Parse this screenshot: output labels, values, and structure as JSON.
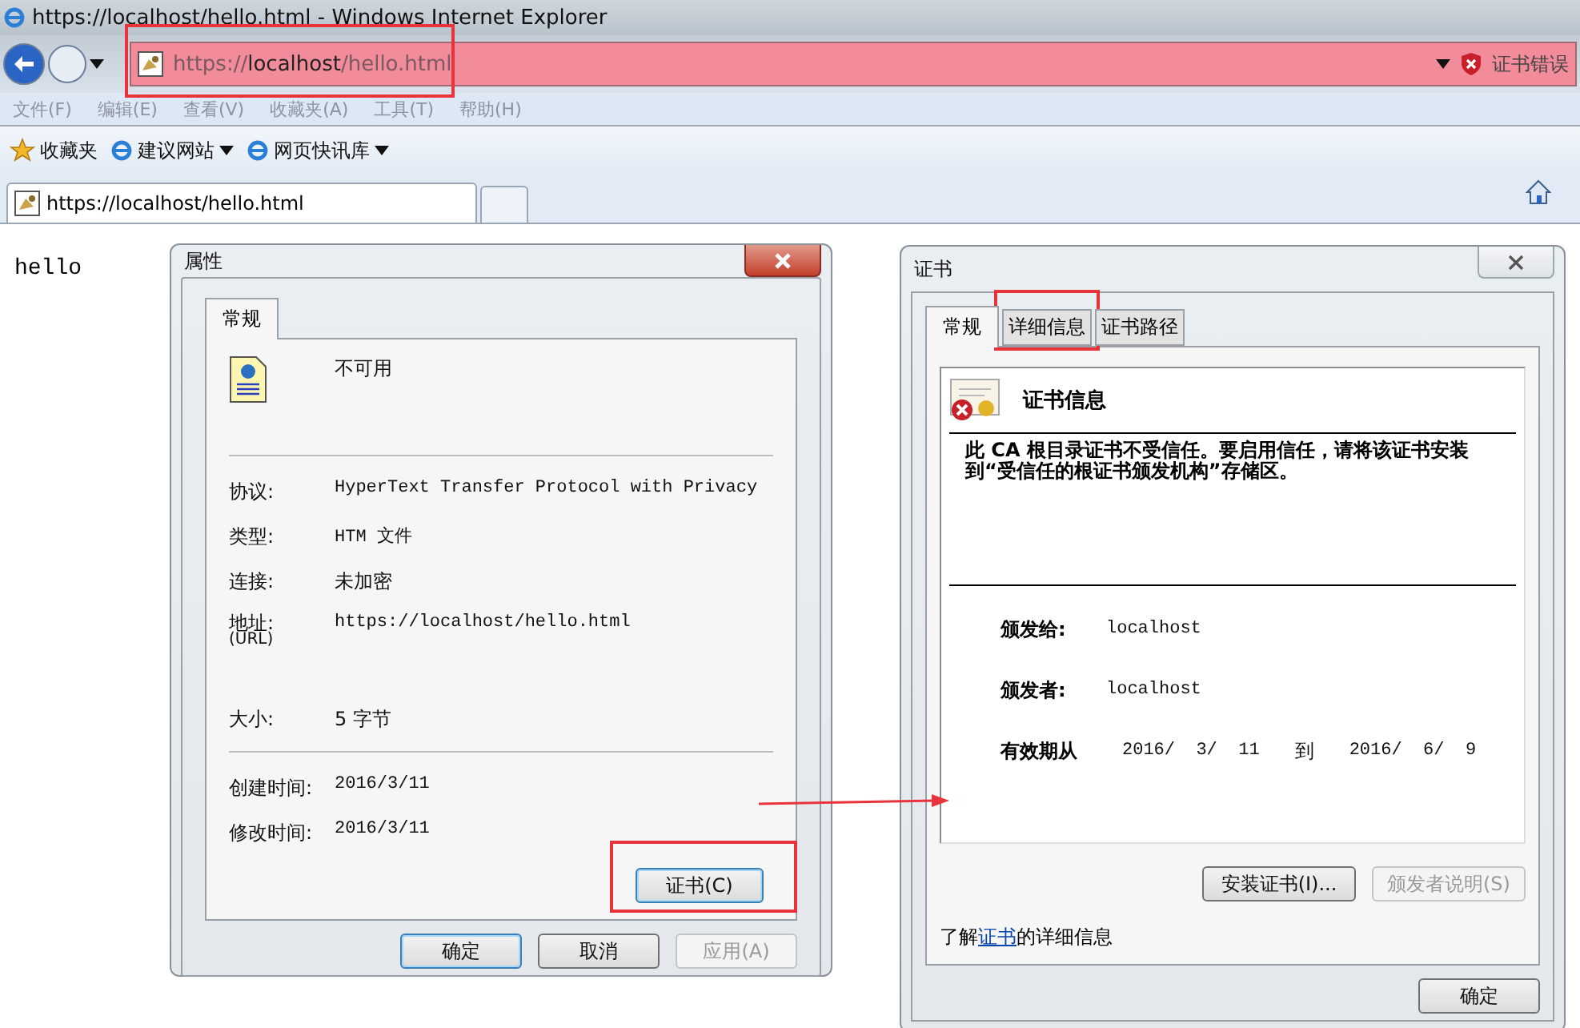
{
  "window": {
    "title": "https://localhost/hello.html - Windows Internet Explorer"
  },
  "address_bar": {
    "url": "https://**localhost**/hello.html",
    "security_status": "证书错误"
  },
  "menu": [
    "文件(F)",
    "编辑(E)",
    "查看(V)",
    "收藏夹(A)",
    "工具(T)",
    "帮助(H)"
  ],
  "favorites_bar": [
    {
      "kind": "favorites",
      "label": "收藏夹"
    },
    {
      "kind": "dropdown",
      "label": "建议网站"
    },
    {
      "kind": "dropdown",
      "label": "网页快讯库"
    }
  ],
  "tabs": [
    {
      "label": "https://localhost/hello.html",
      "selected": true
    }
  ],
  "page": {
    "text": "hello"
  },
  "properties_dialog": {
    "title": "属性",
    "tabs": [
      {
        "label": "常规",
        "selected": true
      }
    ],
    "name": "不可用",
    "fields": [
      {
        "label": "协议:",
        "value": "HyperText Transfer Protocol with Privacy"
      },
      {
        "label": "类型:",
        "value": "HTM 文件"
      },
      {
        "label": "连接:",
        "value": "未加密"
      },
      {
        "label": "地址:",
        "sublabel": "(URL)",
        "value": "https://localhost/hello.html"
      },
      {
        "label": "大小:",
        "value": "5 字节"
      }
    ],
    "dates": [
      {
        "label": "创建时间:",
        "value": "2016/3/11"
      },
      {
        "label": "修改时间:",
        "value": "2016/3/11"
      }
    ],
    "certificate_button": "证书(C)",
    "buttons": [
      {
        "label": "确定",
        "default": true,
        "disabled": false
      },
      {
        "label": "取消",
        "default": false,
        "disabled": false
      },
      {
        "label": "应用(A)",
        "default": false,
        "disabled": true
      }
    ]
  },
  "certificate_dialog": {
    "title": "证书",
    "tabs": [
      {
        "label": "常规",
        "selected": true
      },
      {
        "label": "详细信息",
        "selected": false
      },
      {
        "label": "证书路径",
        "selected": false
      }
    ],
    "heading": "证书信息",
    "warning": "此 CA 根目录证书不受信任。要启用信任，请将该证书安装到“受信任的根证书颁发机构”存储区。",
    "issued_to": {
      "label": "颁发给:",
      "value": "localhost"
    },
    "issued_by": {
      "label": "颁发者:",
      "value": "localhost"
    },
    "validity": {
      "label": "有效期从",
      "from": "2016/  3/  11",
      "to_label": "到",
      "to": "2016/  6/  9"
    },
    "buttons": [
      {
        "label": "安装证书(I)...",
        "disabled": false
      },
      {
        "label": "颁发者说明(S)",
        "disabled": true
      }
    ],
    "info": {
      "before": "了解",
      "link": "证书",
      "after": "的详细信息"
    },
    "ok_button": "确定"
  }
}
